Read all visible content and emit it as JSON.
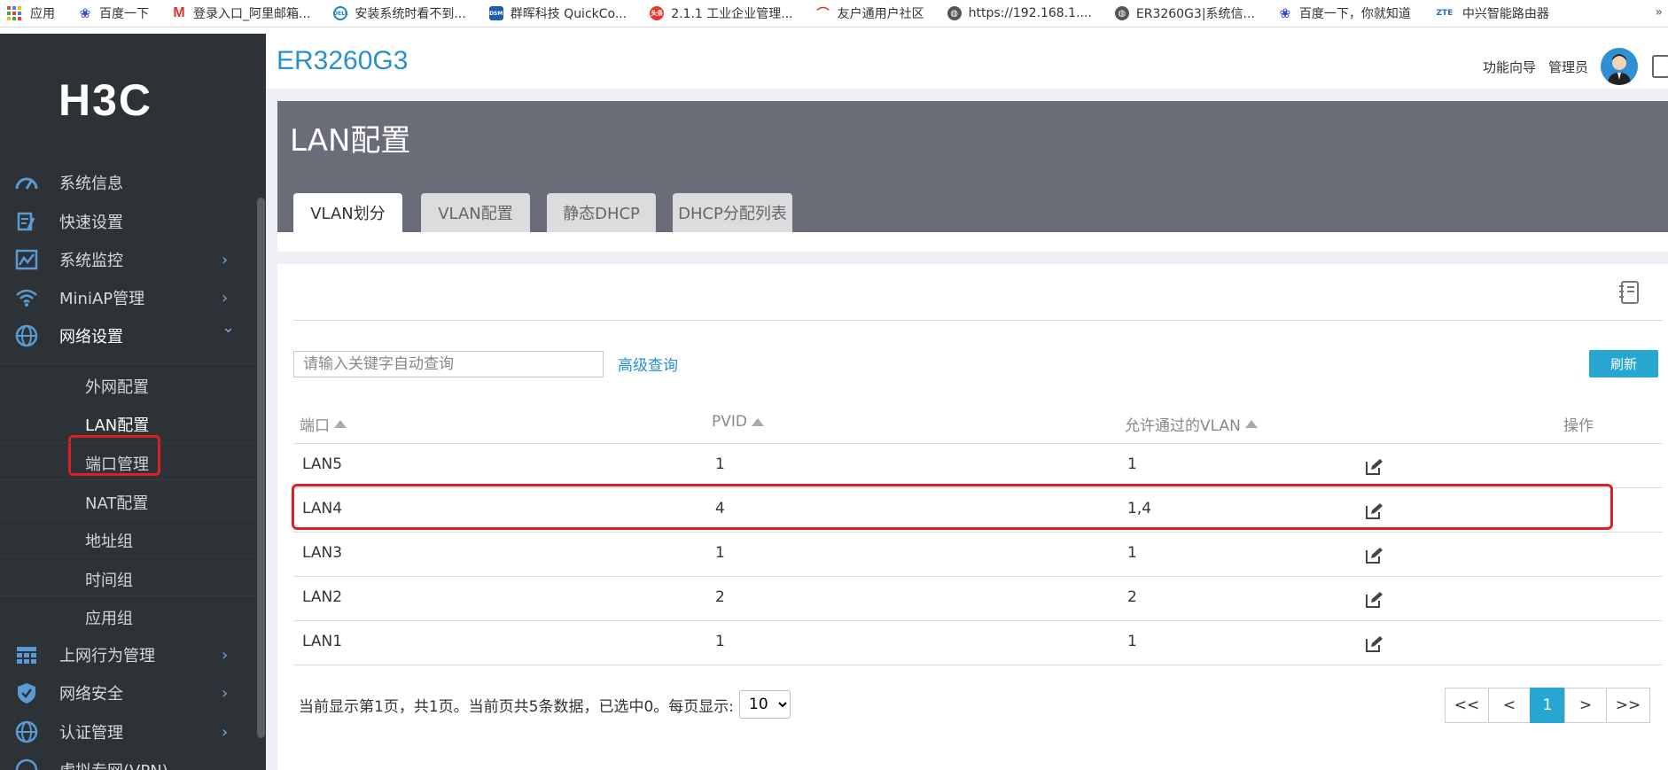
{
  "bookmarks": {
    "items": [
      {
        "label": "应用",
        "icon": "apps-grid-icon"
      },
      {
        "label": "百度一下",
        "icon": "baidu-paw-icon"
      },
      {
        "label": "登录入口_阿里邮箱...",
        "icon": "mail-m-icon"
      },
      {
        "label": "安装系统时看不到...",
        "icon": "dell-icon"
      },
      {
        "label": "群晖科技 QuickCo...",
        "icon": "dsm-icon"
      },
      {
        "label": "2.1.1 工业企业管理...",
        "icon": "toutiao-icon"
      },
      {
        "label": "友户通用户社区",
        "icon": "yonyou-icon"
      },
      {
        "label": "https://192.168.1....",
        "icon": "globe-icon"
      },
      {
        "label": "ER3260G3|系统信...",
        "icon": "globe-icon"
      },
      {
        "label": "百度一下，你就知道",
        "icon": "baidu-paw-icon"
      },
      {
        "label": "中兴智能路由器",
        "icon": "zte-icon"
      }
    ],
    "more": "»"
  },
  "sidebar": {
    "logo": "H3C",
    "menu": [
      {
        "label": "系统信息",
        "icon": "gauge-icon",
        "chevron": ""
      },
      {
        "label": "快速设置",
        "icon": "quick-setup-icon",
        "chevron": ""
      },
      {
        "label": "系统监控",
        "icon": "monitor-chart-icon",
        "chevron": "›"
      },
      {
        "label": "MiniAP管理",
        "icon": "wifi-icon",
        "chevron": "›"
      },
      {
        "label": "网络设置",
        "icon": "network-globe-icon",
        "chevron": "⌄"
      },
      {
        "label": "上网行为管理",
        "icon": "behavior-grid-icon",
        "chevron": "›"
      },
      {
        "label": "网络安全",
        "icon": "shield-icon",
        "chevron": "›"
      },
      {
        "label": "认证管理",
        "icon": "auth-globe-icon",
        "chevron": "›"
      },
      {
        "label": "虚拟专网(VPN)",
        "icon": "vpn-icon",
        "chevron": ""
      }
    ],
    "submenu": [
      "外网配置",
      "LAN配置",
      "端口管理",
      "NAT配置",
      "地址组",
      "时间组",
      "应用组"
    ]
  },
  "header": {
    "brand": "ER3260G3",
    "wizard": "功能向导",
    "user": "管理员"
  },
  "page": {
    "title": "LAN配置",
    "tabs": [
      "VLAN划分",
      "VLAN配置",
      "静态DHCP",
      "DHCP分配列表"
    ],
    "active_tab": "VLAN划分"
  },
  "toolbar": {
    "search_placeholder": "请输入关键字自动查询",
    "advanced": "高级查询",
    "refresh": "刷新"
  },
  "table": {
    "columns": [
      "端口",
      "PVID",
      "允许通过的VLAN",
      "操作"
    ],
    "rows": [
      {
        "port": "LAN5",
        "pvid": "1",
        "vlan": "1"
      },
      {
        "port": "LAN4",
        "pvid": "4",
        "vlan": "1,4"
      },
      {
        "port": "LAN3",
        "pvid": "1",
        "vlan": "1"
      },
      {
        "port": "LAN2",
        "pvid": "2",
        "vlan": "2"
      },
      {
        "port": "LAN1",
        "pvid": "1",
        "vlan": "1"
      }
    ],
    "highlighted_row": "LAN4"
  },
  "footer": {
    "info": "当前显示第1页，共1页。当前页共5条数据，已选中0。每页显示:",
    "per_page": "10",
    "pager": [
      "<<",
      "<",
      "1",
      ">",
      ">>"
    ]
  },
  "colors": {
    "sidebar_bg": "#2d3237",
    "accent_blue": "#27a6d2",
    "brand_blue": "#2a8fd0",
    "title_band": "#6a6c78",
    "highlight_red": "#e02020"
  }
}
